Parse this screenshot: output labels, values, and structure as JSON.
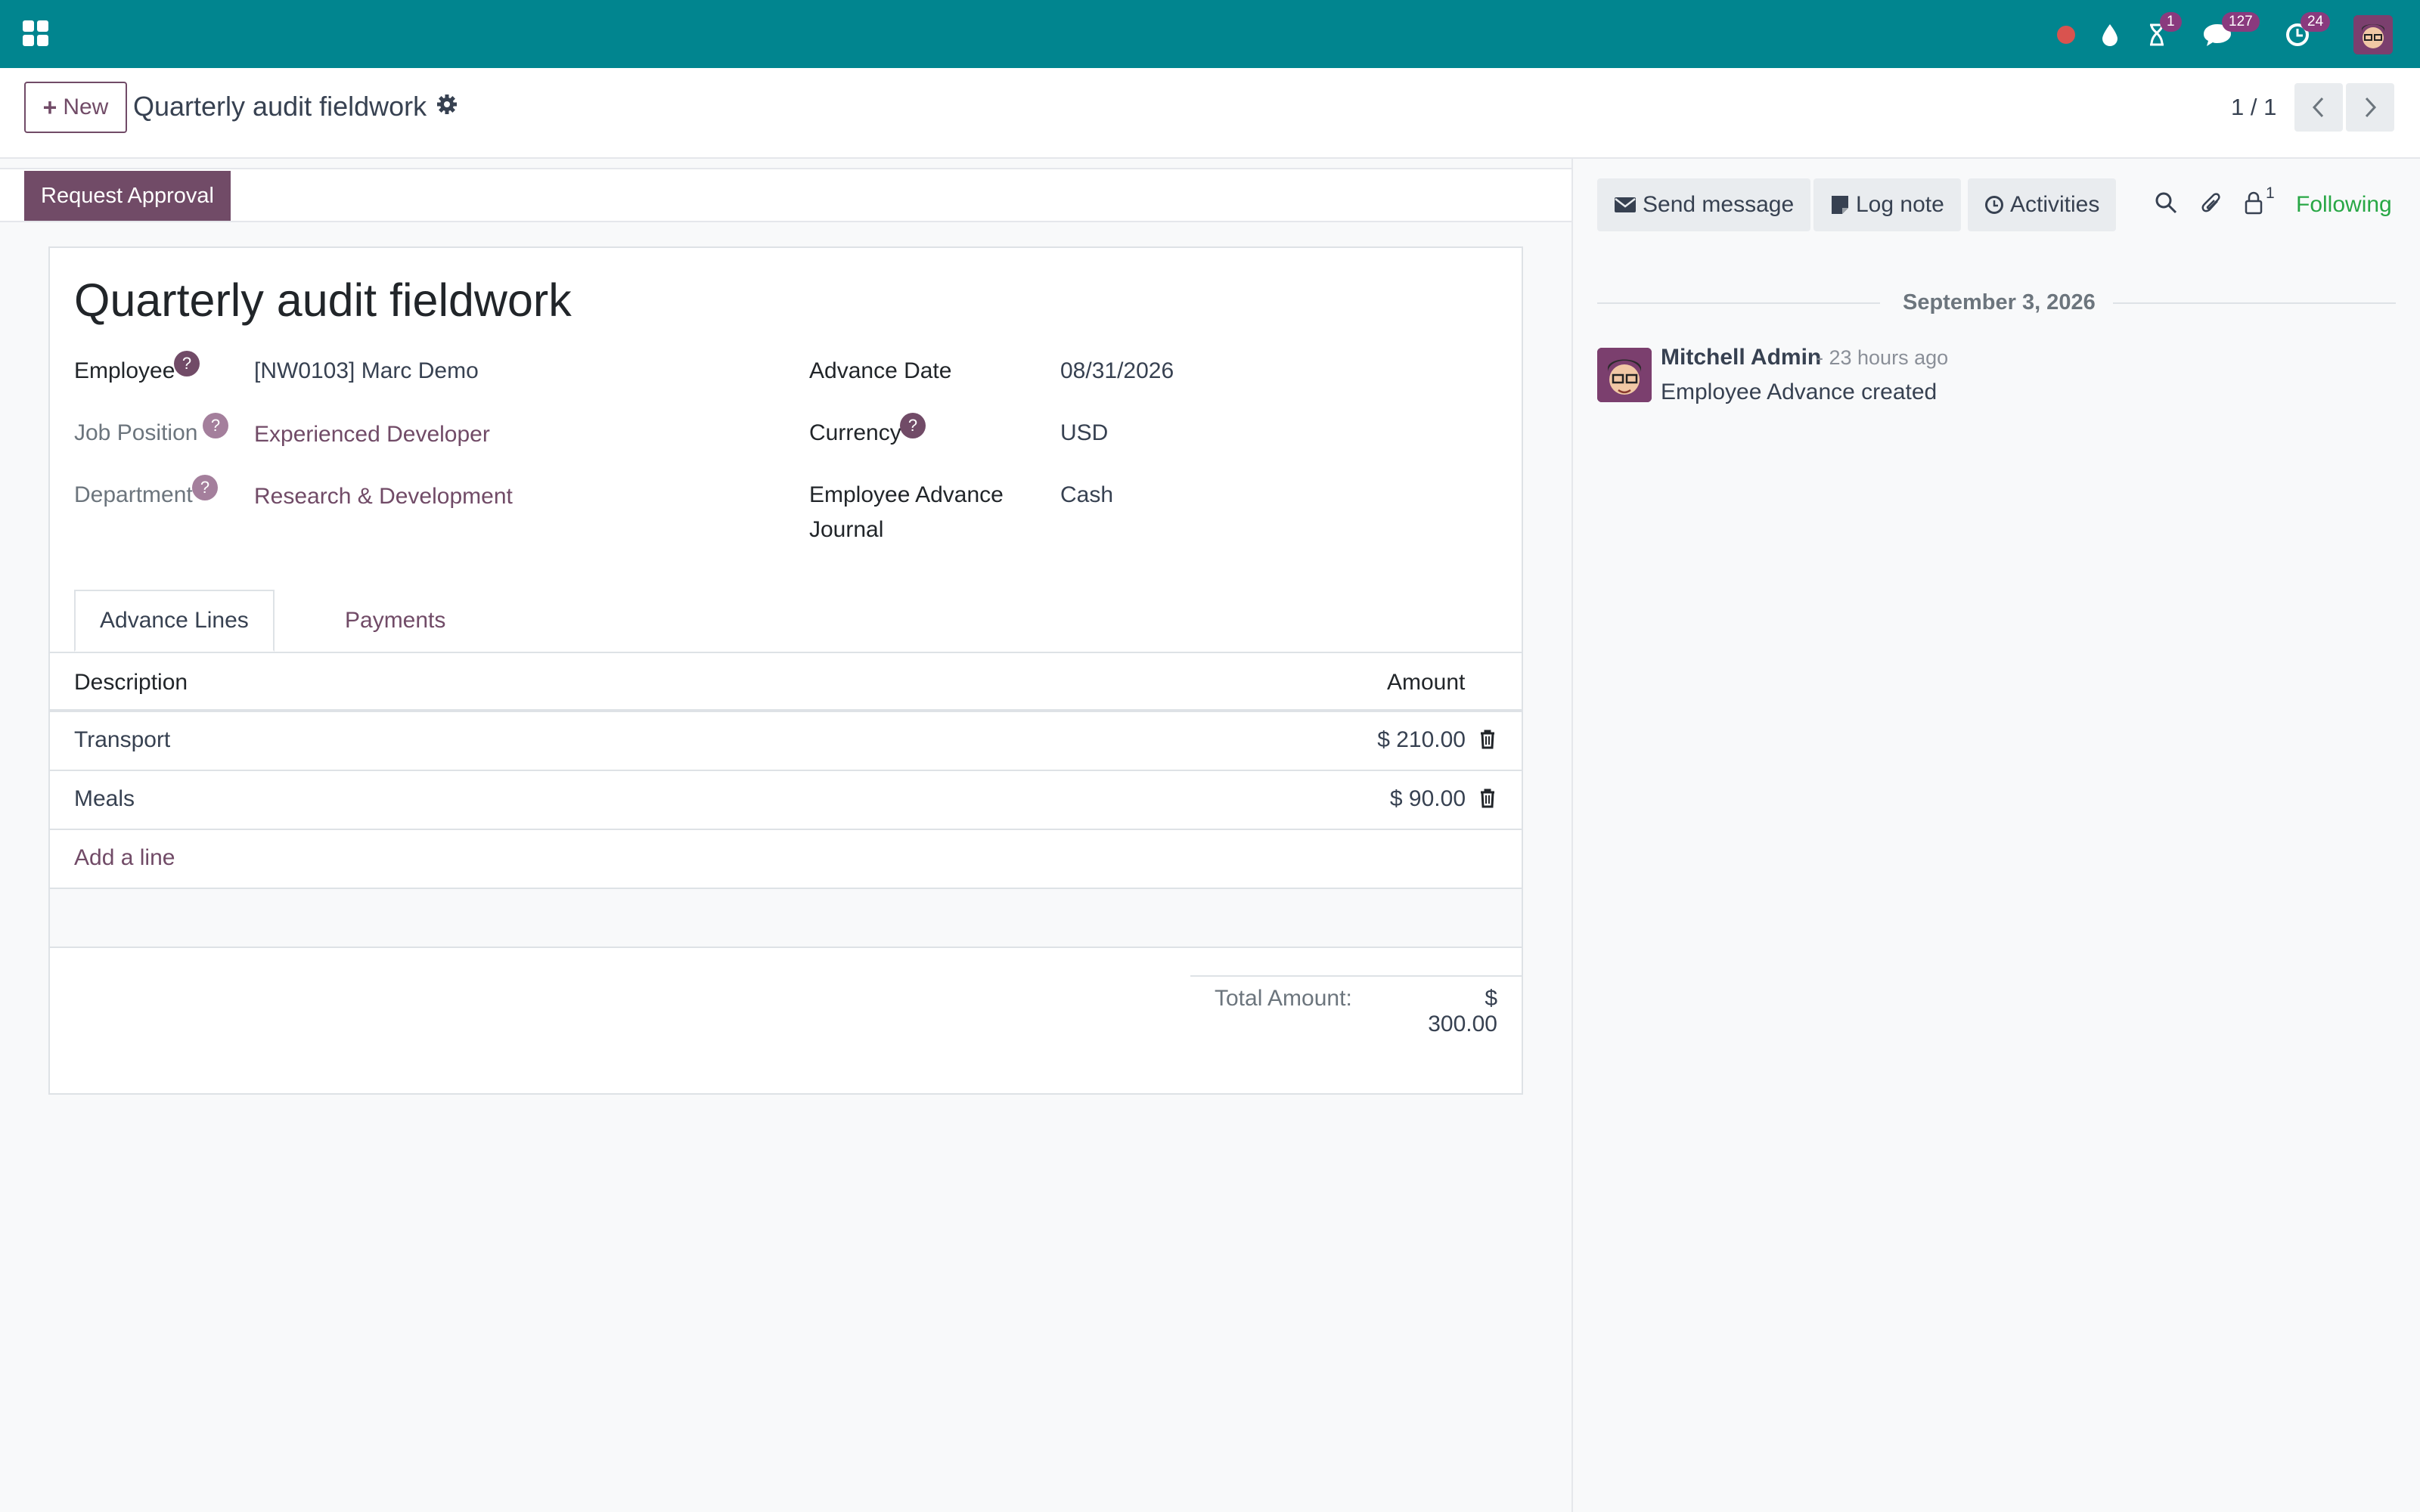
{
  "topbar": {
    "apps_icon": "grid-apps-icon",
    "icons": [
      "recording-dot-icon",
      "droplet-icon",
      "hourglass-icon",
      "chat-icon",
      "clock-icon",
      "user-avatar"
    ],
    "hourglass_badge": "1",
    "chat_badge": "127",
    "clock_badge": "24",
    "bar_color": "#01858f"
  },
  "control": {
    "new_label": "New",
    "breadcrumb_title": "Quarterly audit fieldwork",
    "pager": "1 / 1"
  },
  "statusbar": {
    "request_approval_label": "Request Approval"
  },
  "form": {
    "title": "Quarterly audit fieldwork",
    "fields_left": [
      {
        "label": "Employee",
        "value": "[NW0103] Marc Demo"
      },
      {
        "label": "Job Position",
        "value": "Experienced Developer"
      },
      {
        "label": "Department",
        "value": "Research & Development"
      }
    ],
    "fields_right": [
      {
        "label": "Advance Date",
        "value": "08/31/2026"
      },
      {
        "label": "Currency",
        "value": "USD"
      },
      {
        "label_line1": "Employee Advance",
        "label_line2": "Journal",
        "value": "Cash"
      }
    ],
    "help_mark": "?",
    "tabs": [
      {
        "label": "Advance Lines",
        "active": true
      },
      {
        "label": "Payments",
        "active": false
      }
    ],
    "table": {
      "headers": [
        "Description",
        "Amount"
      ],
      "rows": [
        {
          "description": "Transport",
          "amount": "$ 210.00"
        },
        {
          "description": "Meals",
          "amount": "$ 90.00"
        }
      ],
      "add_line": "Add a line"
    },
    "total_label": "Total Amount:",
    "total_value": "$ 300.00"
  },
  "chatter": {
    "send_message": "Send message",
    "log_note": "Log note",
    "activities": "Activities",
    "followers_count": "1",
    "following": "Following",
    "date_separator": "September 3, 2026",
    "message": {
      "author": "Mitchell Admin",
      "time": "- 23 hours ago",
      "body": "Employee Advance created"
    }
  },
  "colors": {
    "brand": "#714b67",
    "topbar": "#01858f",
    "following": "#28a745"
  }
}
